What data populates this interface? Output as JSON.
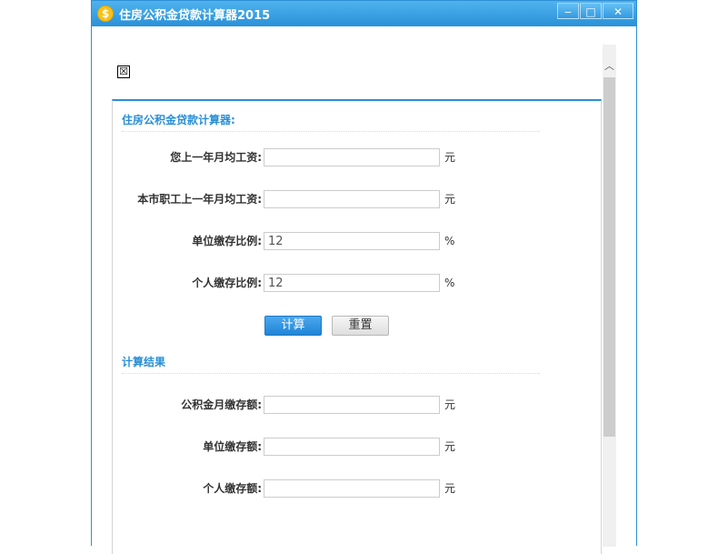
{
  "window": {
    "title": "住房公积金贷款计算器2015",
    "app_icon": "$",
    "controls": {
      "minimize": "‒",
      "maximize": "□",
      "close": "✕"
    }
  },
  "broken_image_glyph": "☒",
  "calculator": {
    "section_title": "住房公积金贷款计算器:",
    "fields": [
      {
        "label": "您上一年月均工资:",
        "value": "",
        "unit": "元"
      },
      {
        "label": "本市职工上一年月均工资:",
        "value": "",
        "unit": "元"
      },
      {
        "label": "单位缴存比例:",
        "value": "12",
        "unit": "%"
      },
      {
        "label": "个人缴存比例:",
        "value": "12",
        "unit": "%"
      }
    ],
    "buttons": {
      "calculate": "计算",
      "reset": "重置"
    }
  },
  "results": {
    "section_title": "计算结果",
    "fields": [
      {
        "label": "公积金月缴存额:",
        "value": "",
        "unit": "元"
      },
      {
        "label": "单位缴存额:",
        "value": "",
        "unit": "元"
      },
      {
        "label": "个人缴存额:",
        "value": "",
        "unit": "元"
      }
    ]
  },
  "scrollbar": {
    "up_arrow": "︿"
  }
}
